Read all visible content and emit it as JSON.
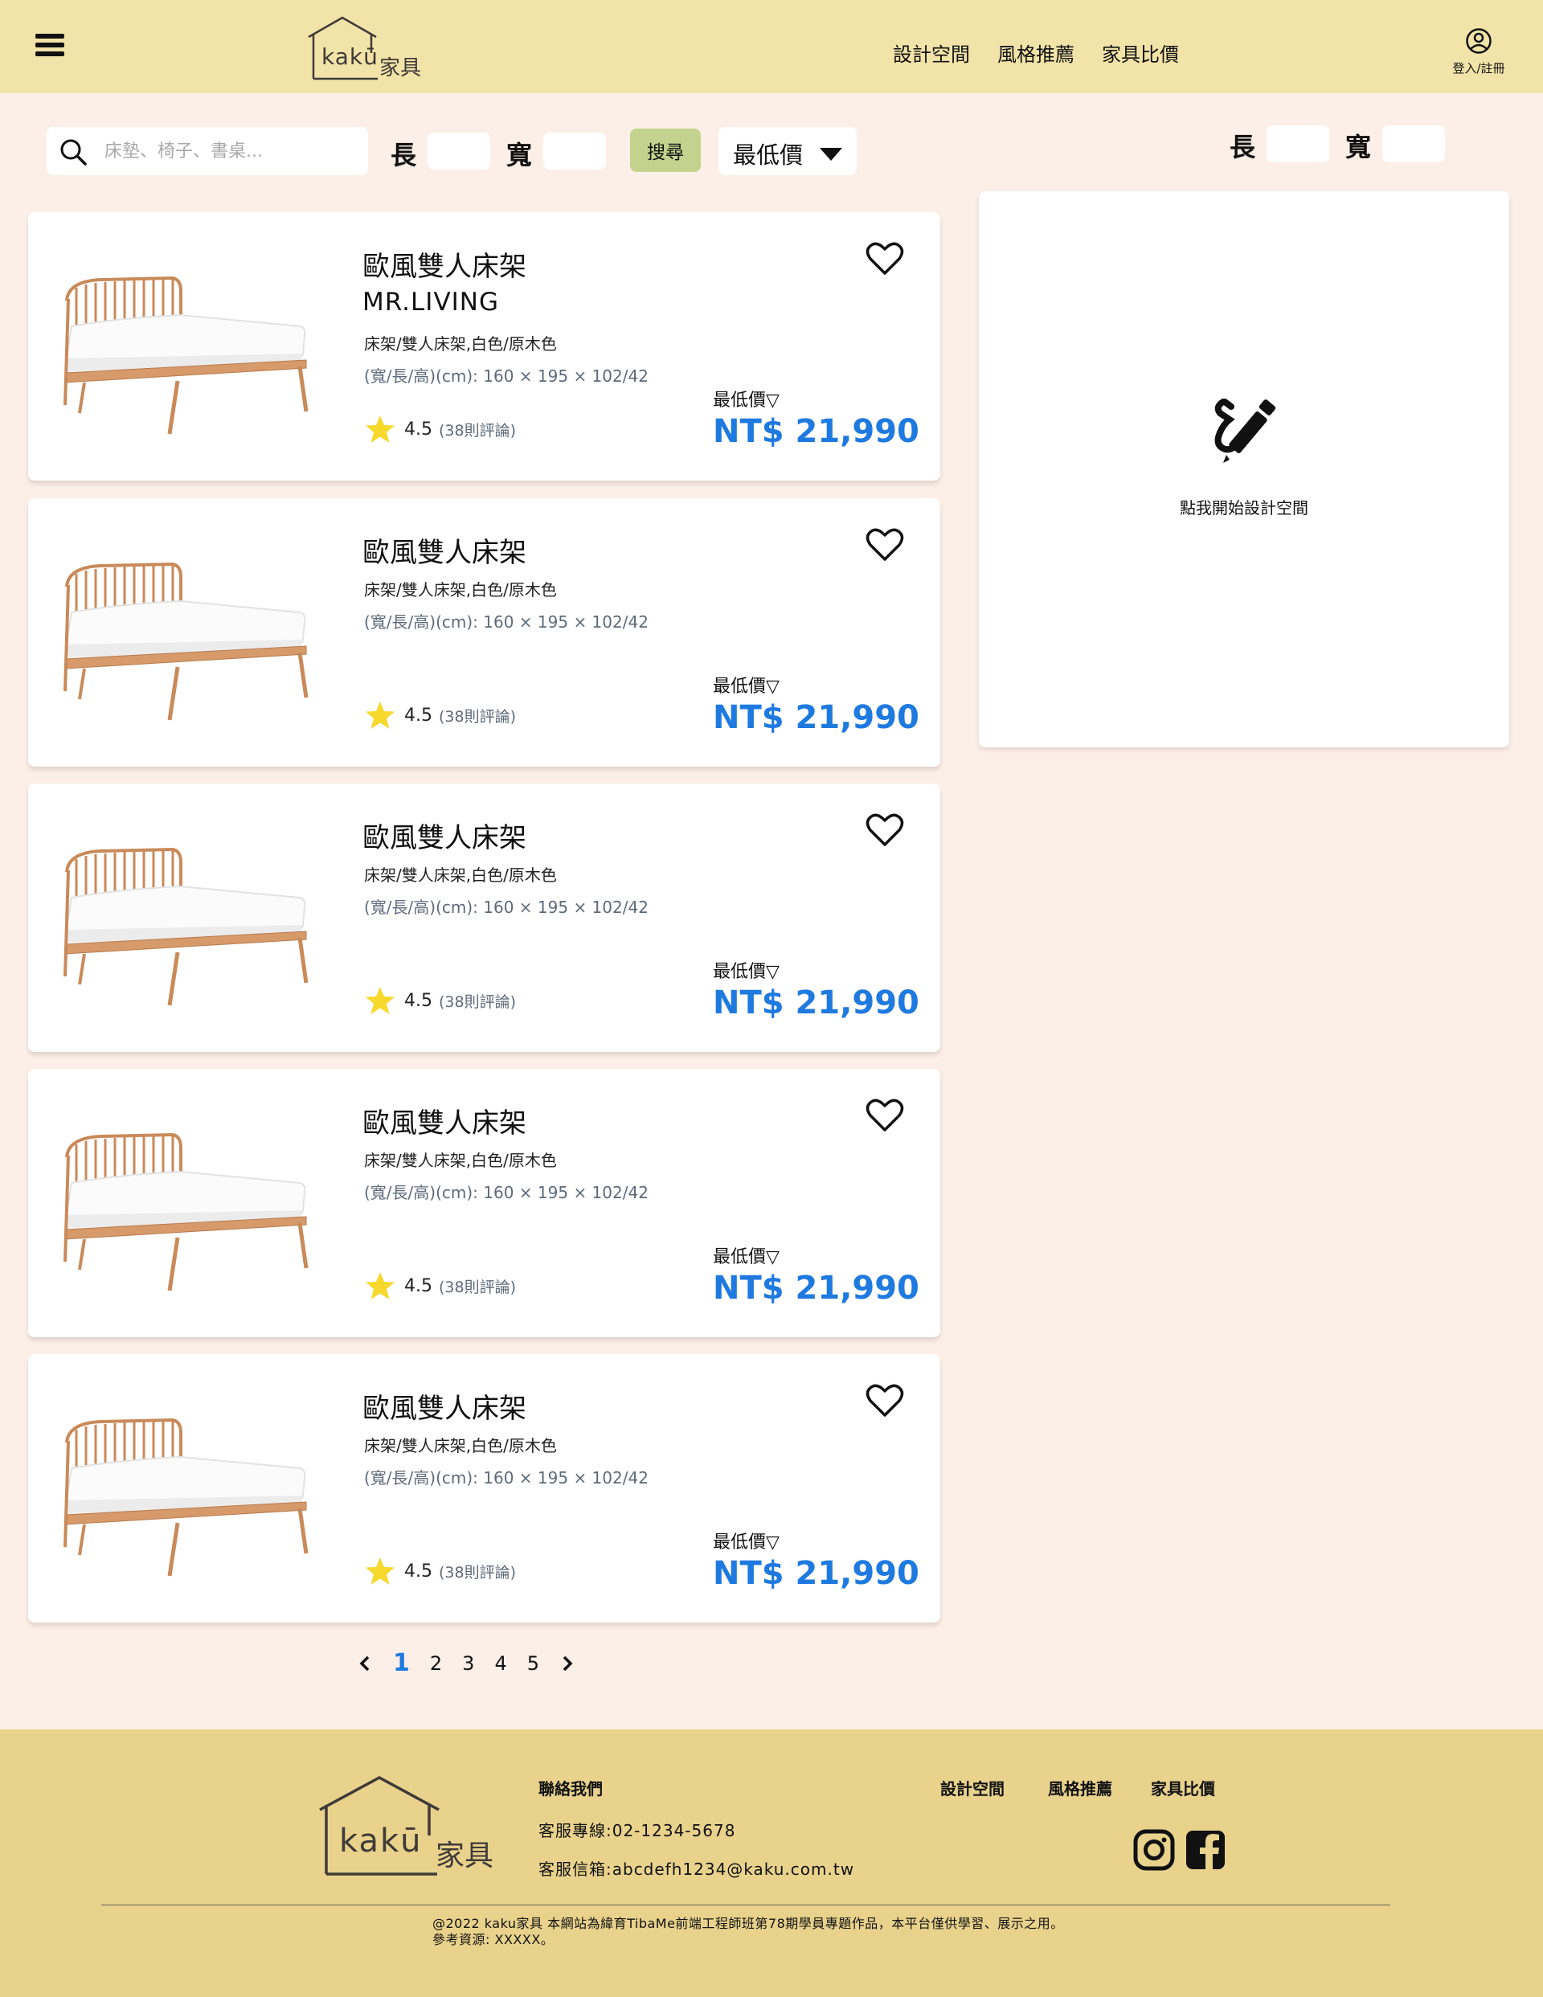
{
  "header": {
    "logo_text": "kakū",
    "logo_subtext": "家具",
    "nav": [
      "設計空間",
      "風格推薦",
      "家具比價"
    ],
    "user_label": "登入/註冊"
  },
  "search": {
    "placeholder": "床墊、椅子、書桌...",
    "length_label": "長",
    "width_label": "寬",
    "button_label": "搜尋",
    "sort_label": "最低價"
  },
  "products": [
    {
      "name": "歐風雙人床架",
      "brand": "MR.LIVING",
      "category": "床架/雙人床架,白色/原木色",
      "dimensions": "(寬/長/高)(cm): 160 × 195 × 102/42",
      "rating": "4.5",
      "reviews": "(38則評論)",
      "price_label": "最低價▽",
      "price": "NT$ 21,990"
    },
    {
      "name": "歐風雙人床架",
      "brand": "",
      "category": "床架/雙人床架,白色/原木色",
      "dimensions": "(寬/長/高)(cm): 160 × 195 × 102/42",
      "rating": "4.5",
      "reviews": "(38則評論)",
      "price_label": "最低價▽",
      "price": "NT$ 21,990"
    },
    {
      "name": "歐風雙人床架",
      "brand": "",
      "category": "床架/雙人床架,白色/原木色",
      "dimensions": "(寬/長/高)(cm): 160 × 195 × 102/42",
      "rating": "4.5",
      "reviews": "(38則評論)",
      "price_label": "最低價▽",
      "price": "NT$ 21,990"
    },
    {
      "name": "歐風雙人床架",
      "brand": "",
      "category": "床架/雙人床架,白色/原木色",
      "dimensions": "(寬/長/高)(cm): 160 × 195 × 102/42",
      "rating": "4.5",
      "reviews": "(38則評論)",
      "price_label": "最低價▽",
      "price": "NT$ 21,990"
    },
    {
      "name": "歐風雙人床架",
      "brand": "",
      "category": "床架/雙人床架,白色/原木色",
      "dimensions": "(寬/長/高)(cm): 160 × 195 × 102/42",
      "rating": "4.5",
      "reviews": "(38則評論)",
      "price_label": "最低價▽",
      "price": "NT$ 21,990"
    }
  ],
  "right_panel": {
    "length_label": "長",
    "width_label": "寬",
    "design_text": "點我開始設計空間"
  },
  "pagination": {
    "pages": [
      "1",
      "2",
      "3",
      "4",
      "5"
    ],
    "current": "1"
  },
  "footer": {
    "logo_text": "kakū",
    "logo_subtext": "家具",
    "contact_title": "聯絡我們",
    "phone": "客服專線:02-1234-5678",
    "email": "客服信箱:abcdefh1234@kaku.com.tw",
    "nav": [
      "設計空間",
      "風格推薦",
      "家具比價"
    ],
    "copyright_1": "@2022 kaku家具 本網站為緯育TibaMe前端工程師班第78期學員專題作品，本平台僅供學習、展示之用。",
    "copyright_2": "參考資源: XXXXX。"
  },
  "colors": {
    "header_bg": "#f2e3a8",
    "page_bg": "#fcefe7",
    "footer_bg": "#e8d28c",
    "price_blue": "#1f7ae0",
    "search_button": "#c3d38d"
  }
}
